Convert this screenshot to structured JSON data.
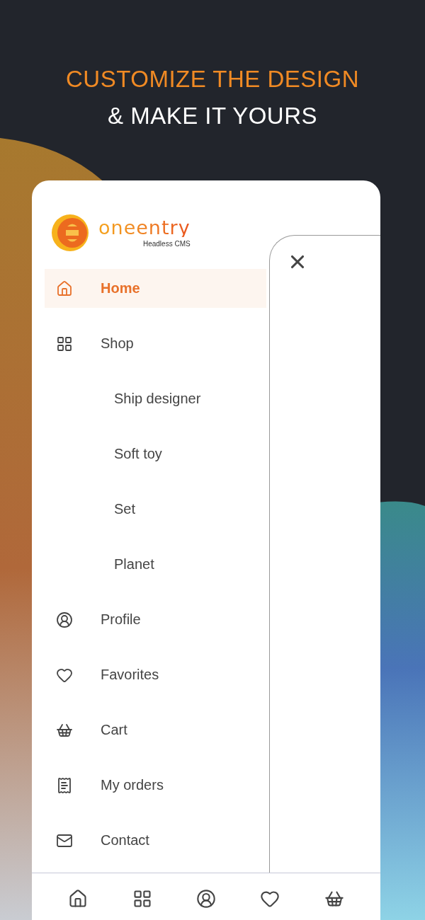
{
  "headline": {
    "accent": "CUSTOMIZE THE DESIGN",
    "rest": "& MAKE IT YOURS"
  },
  "logo": {
    "wordmark": "oneentry",
    "tagline": "Headless CMS"
  },
  "menu": [
    {
      "label": "Home",
      "selected": true
    },
    {
      "label": "Shop",
      "selected": false,
      "children": [
        {
          "label": "Ship designer",
          "selected": false
        },
        {
          "label": "Soft toy",
          "selected": false
        },
        {
          "label": "Set",
          "selected": false
        },
        {
          "label": "Planet",
          "selected": false
        }
      ]
    },
    {
      "label": "Profile",
      "selected": false
    },
    {
      "label": "Favorites",
      "selected": false
    },
    {
      "label": "Cart",
      "selected": false
    },
    {
      "label": "My orders",
      "selected": false
    },
    {
      "label": "Contact",
      "selected": false
    }
  ]
}
